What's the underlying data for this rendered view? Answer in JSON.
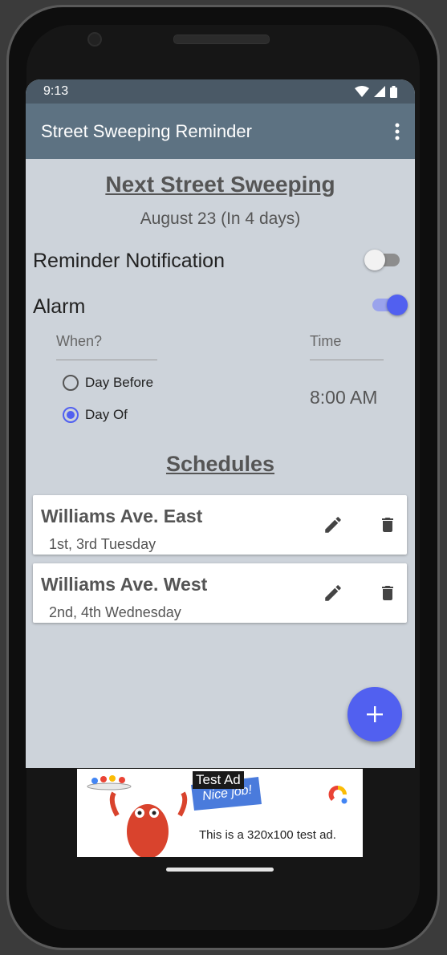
{
  "status_bar": {
    "time": "9:13"
  },
  "app_bar": {
    "title": "Street Sweeping Reminder",
    "menu_icon": "more-vert-icon"
  },
  "next": {
    "title": "Next Street Sweeping",
    "date": "August 23 (In 4 days)"
  },
  "reminder": {
    "label": "Reminder Notification",
    "enabled": false
  },
  "alarm": {
    "label": "Alarm",
    "enabled": true,
    "when_label": "When?",
    "time_label": "Time",
    "options": [
      {
        "label": "Day Before",
        "selected": false
      },
      {
        "label": "Day Of",
        "selected": true
      }
    ],
    "time_value": "8:00 AM"
  },
  "schedules": {
    "title": "Schedules",
    "items": [
      {
        "name": "Williams Ave. East",
        "days": "1st, 3rd Tuesday"
      },
      {
        "name": "Williams Ave. West",
        "days": "2nd, 4th Wednesday"
      }
    ]
  },
  "fab_icon": "add-icon",
  "ad": {
    "label": "Test Ad",
    "text": "This is a 320x100 test ad.",
    "banner": "Nice job!"
  },
  "colors": {
    "accent": "#5160f0",
    "app_bar": "#5d7282",
    "status_bar": "#4a5966",
    "background": "#cdd3da"
  }
}
